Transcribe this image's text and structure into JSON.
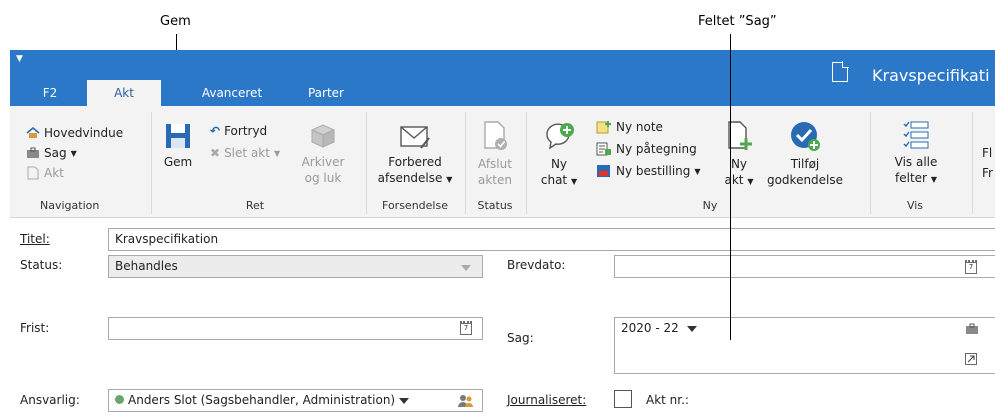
{
  "callouts": {
    "save": "Gem",
    "case_field": "Feltet ”Sag”"
  },
  "window": {
    "title": "Kravspecifikati"
  },
  "tabs": [
    {
      "label": "F2"
    },
    {
      "label": "Akt"
    },
    {
      "label": "Avanceret"
    },
    {
      "label": "Parter"
    }
  ],
  "ribbon": {
    "navigation": {
      "label": "Navigation",
      "main_window": "Hovedvindue",
      "case": "Sag",
      "document": "Akt"
    },
    "edit": {
      "label": "Ret",
      "save": "Gem",
      "undo": "Fortryd",
      "delete": "Slet akt",
      "archive_line1": "Arkiver",
      "archive_line2": "og luk"
    },
    "dispatch": {
      "label": "Forsendelse",
      "prepare_line1": "Forbered",
      "prepare_line2": "afsendelse"
    },
    "status": {
      "label": "Status",
      "finish_line1": "Afslut",
      "finish_line2": "akten"
    },
    "new": {
      "label": "Ny",
      "chat_line1": "Ny",
      "chat_line2": "chat",
      "note": "Ny note",
      "endorsement": "Ny påtegning",
      "order": "Ny bestilling",
      "doc_line1": "Ny",
      "doc_line2": "akt",
      "approval_line1": "Tilføj",
      "approval_line2": "godkendelse"
    },
    "view": {
      "label": "Vis",
      "all_line1": "Vis alle",
      "all_line2": "felter"
    },
    "cut_off": {
      "line1": "Fl",
      "line2": "Fr"
    }
  },
  "form": {
    "title_label": "Titel:",
    "title_value": "Kravspecifikation",
    "status_label": "Status:",
    "status_value": "Behandles",
    "deadline_label": "Frist:",
    "deadline_value": "",
    "letter_date_label": "Brevdato:",
    "letter_date_value": "",
    "case_label": "Sag:",
    "case_value": "2020 - 22",
    "responsible_label": "Ansvarlig:",
    "responsible_value": "Anders Slot (Sagsbehandler, Administration)",
    "journalized_label": "Journaliseret:",
    "doc_no_label": "Akt nr.:",
    "calendar_glyph": "7"
  },
  "colors": {
    "titlebar": "#2b78c9",
    "ribbon": "#f3f3f3",
    "status_dot": "#6aa56a",
    "icon_blue": "#2a6ab3",
    "icon_green": "#4ea84e"
  }
}
